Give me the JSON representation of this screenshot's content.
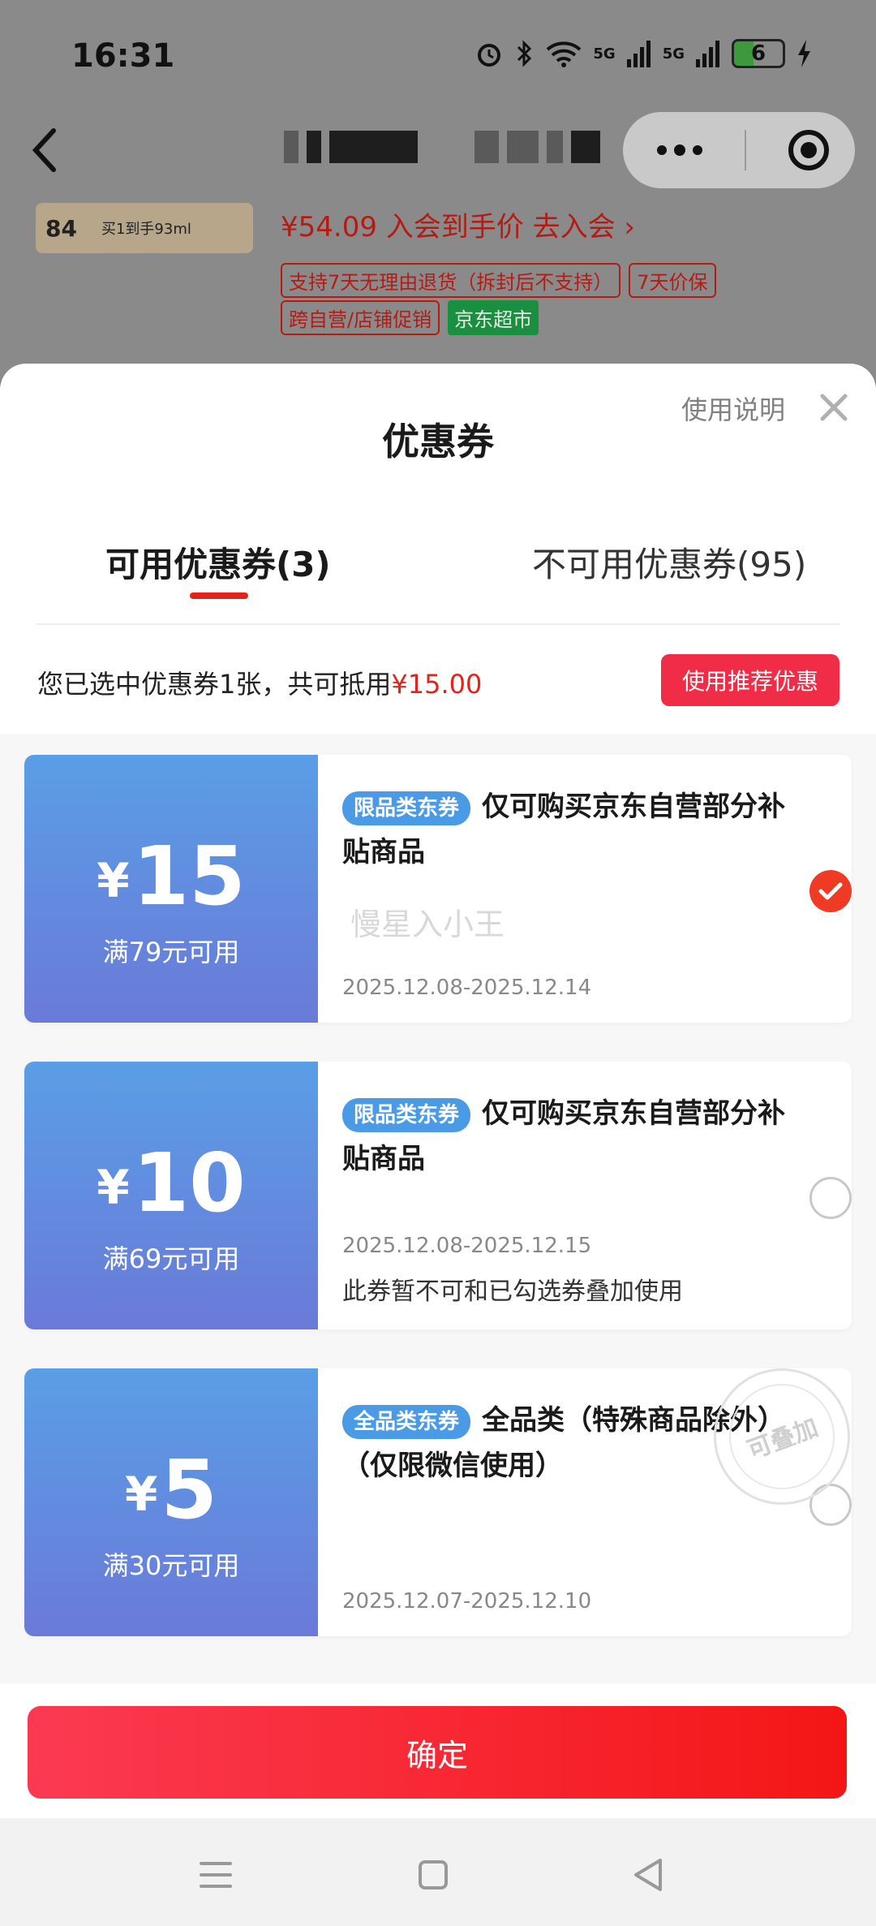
{
  "status_bar": {
    "time": "16:31",
    "network_1": "5G",
    "network_2": "5G",
    "battery": "6"
  },
  "background_page": {
    "thumb_number": "84",
    "thumb_tag": "买1到手93ml",
    "member_price": "¥54.09 入会到手价 去入会 ›",
    "tags_row1": [
      "支持7天无理由退货（拆封后不支持）",
      "7天价保"
    ],
    "tags_row2_outline": "跨自营/店铺促销",
    "tags_row2_green": "京东超市"
  },
  "sheet": {
    "title": "优惠券",
    "help_link": "使用说明",
    "tabs": {
      "available": "可用优惠券(3)",
      "unavailable": "不可用优惠券(95)"
    },
    "summary": {
      "text": "您已选中优惠券1张，共可抵用",
      "amount": "¥15.00"
    },
    "recommend_button": "使用推荐优惠",
    "watermark": "慢星入小王",
    "coupons": [
      {
        "yen": "¥",
        "amount": "15",
        "condition": "满79元可用",
        "badge": "限品类东券",
        "description": "仅可购买京东自营部分补贴商品",
        "date": "2025.12.08-2025.12.14",
        "note": "",
        "selected": true
      },
      {
        "yen": "¥",
        "amount": "10",
        "condition": "满69元可用",
        "badge": "限品类东券",
        "description": "仅可购买京东自营部分补贴商品",
        "date": "2025.12.08-2025.12.15",
        "note": "此券暂不可和已勾选券叠加使用",
        "selected": false
      },
      {
        "yen": "¥",
        "amount": "5",
        "condition": "满30元可用",
        "badge": "全品类东券",
        "description": "全品类（特殊商品除外）（仅限微信使用）",
        "date": "2025.12.07-2025.12.10",
        "note": "",
        "stamp": "可叠加",
        "selected": false
      }
    ],
    "confirm_button": "确定"
  },
  "colors": {
    "accent_red": "#e3231b",
    "coupon_blue": "#5a9ee6",
    "confirm_red": "#f41616"
  }
}
